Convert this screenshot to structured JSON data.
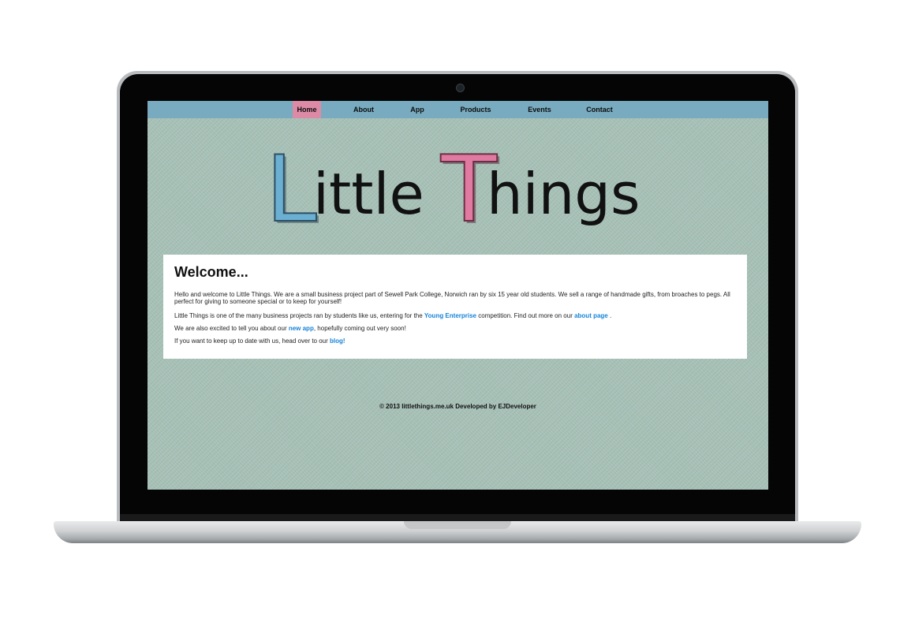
{
  "nav": {
    "items": [
      {
        "label": "Home",
        "active": true
      },
      {
        "label": "About",
        "active": false
      },
      {
        "label": "App",
        "active": false
      },
      {
        "label": "Products",
        "active": false
      },
      {
        "label": "Events",
        "active": false
      },
      {
        "label": "Contact",
        "active": false
      }
    ]
  },
  "logo": {
    "first_letter": "L",
    "first_rest": "ittle",
    "second_letter": "T",
    "second_rest": "hings"
  },
  "welcome": {
    "heading": "Welcome...",
    "p1": "Hello and welcome to Little Things. We are a small business project part of Sewell Park College, Norwich ran by six 15 year old students. We sell a range of handmade gifts, from broaches to pegs. All perfect for giving to someone special or to keep for yourself!",
    "p2_before": "Little Things is one of the many business projects ran by students like us, entering for the ",
    "p2_link1": "Young Enterprise",
    "p2_middle": " competition. Find out more on our ",
    "p2_link2": "about page",
    "p2_after": " .",
    "p3_before": "We are also excited to tell you about our ",
    "p3_link": "new app",
    "p3_after": ", hopefully coming out very soon!",
    "p4_before": "If you want to keep up to date with us, head over to our ",
    "p4_link": "blog!"
  },
  "footer": {
    "text": "© 2013 littlethings.me.uk Developed by EJDeveloper"
  },
  "colors": {
    "nav_bg": "#78abbf",
    "nav_active": "#dc8aa6",
    "link": "#1683d8",
    "logo_blue": "#6bb0d2",
    "logo_pink": "#e07aa0",
    "background": "#a6c0b6"
  }
}
